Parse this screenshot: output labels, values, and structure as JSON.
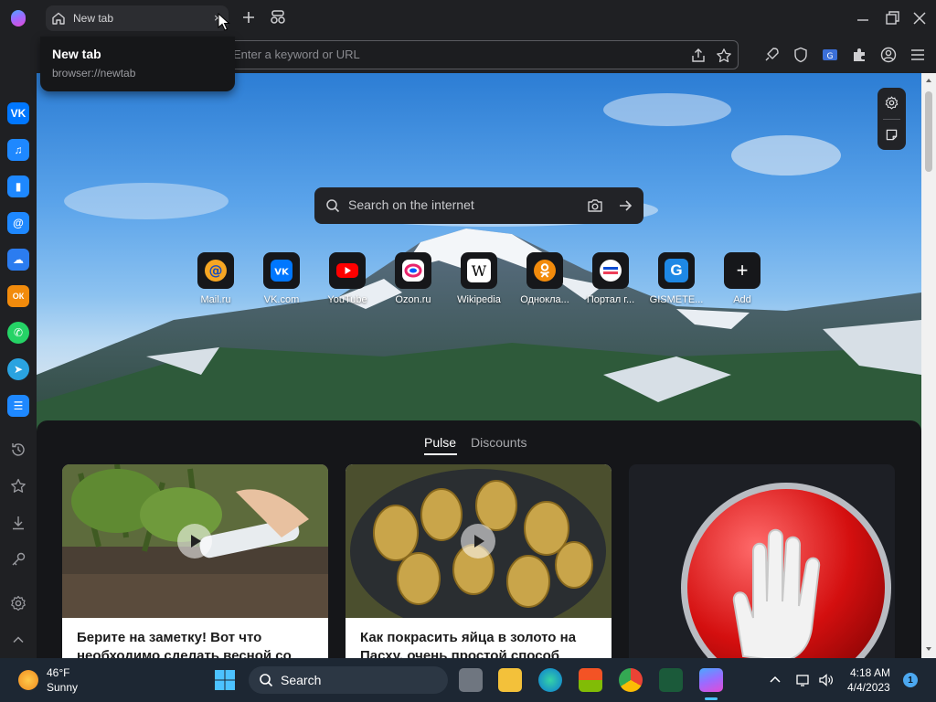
{
  "tab": {
    "title": "New tab",
    "close_glyph": "×"
  },
  "tooltip": {
    "title": "New tab",
    "url": "browser://newtab"
  },
  "omnibox": {
    "placeholder": "Enter a keyword or URL"
  },
  "page": {
    "search_placeholder": "Search on the internet",
    "tiles": [
      {
        "label": "Mail.ru",
        "icon": "mailru-icon"
      },
      {
        "label": "VK.com",
        "icon": "vk-icon"
      },
      {
        "label": "YouTube",
        "icon": "youtube-icon"
      },
      {
        "label": "Ozon.ru",
        "icon": "ozon-icon"
      },
      {
        "label": "Wikipedia",
        "icon": "wikipedia-icon",
        "glyph": "W"
      },
      {
        "label": "Однокла...",
        "icon": "odnoklassniki-icon"
      },
      {
        "label": "Портал г...",
        "icon": "gosuslugi-icon"
      },
      {
        "label": "GISMETE...",
        "icon": "gismeteo-icon",
        "glyph": "G"
      },
      {
        "label": "Add",
        "icon": "plus-icon",
        "glyph": "+"
      }
    ],
    "feed_tabs": {
      "pulse": "Pulse",
      "discounts": "Discounts"
    },
    "cards": [
      {
        "title": "Берите на заметку! Вот что необходимо сделать весной со"
      },
      {
        "title": "Как покрасить яйца в золото на Пасху, очень простой способ"
      }
    ]
  },
  "sidebar": {
    "apps": [
      {
        "name": "vk",
        "glyph": "VK",
        "color": "#0077ff"
      },
      {
        "name": "music",
        "glyph": "♫",
        "color": "#1e88ff"
      },
      {
        "name": "stats",
        "glyph": "▮",
        "color": "#1e88ff"
      },
      {
        "name": "mail",
        "glyph": "@",
        "color": "#1e88ff"
      },
      {
        "name": "cloud",
        "glyph": "☁",
        "color": "#2b7cf0"
      },
      {
        "name": "odnoklassniki",
        "glyph": "ОК",
        "color": "#f28b0c"
      },
      {
        "name": "whatsapp",
        "glyph": "✆",
        "color": "#25d366"
      },
      {
        "name": "telegram",
        "glyph": "➤",
        "color": "#2aa3e0"
      },
      {
        "name": "tasks",
        "glyph": "☰",
        "color": "#1e88ff"
      }
    ]
  },
  "taskbar": {
    "weather_temp": "46°F",
    "weather_condition": "Sunny",
    "search_label": "Search",
    "time": "4:18 AM",
    "date": "4/4/2023",
    "notification_count": "1"
  }
}
